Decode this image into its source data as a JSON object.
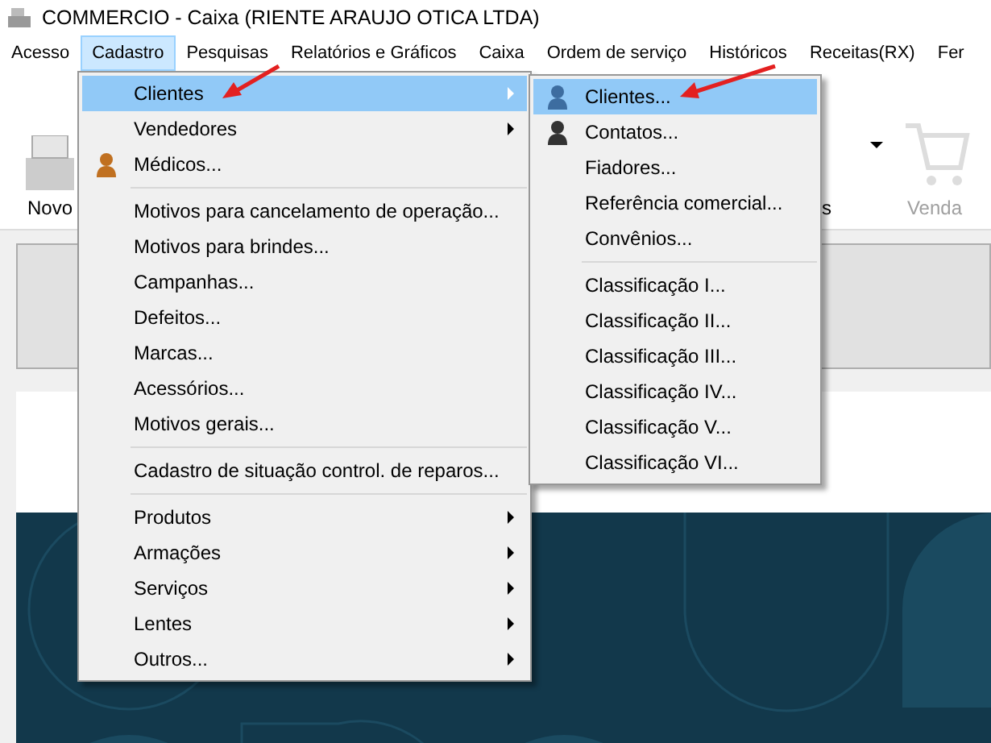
{
  "window": {
    "title": "COMMERCIO - Caixa (RIENTE ARAUJO OTICA LTDA)"
  },
  "menubar": [
    {
      "label": "Acesso",
      "selected": false
    },
    {
      "label": "Cadastro",
      "selected": true
    },
    {
      "label": "Pesquisas",
      "selected": false
    },
    {
      "label": "Relatórios e Gráficos",
      "selected": false
    },
    {
      "label": "Caixa",
      "selected": false
    },
    {
      "label": "Ordem de serviço",
      "selected": false
    },
    {
      "label": "Históricos",
      "selected": false
    },
    {
      "label": "Receitas(RX)",
      "selected": false
    },
    {
      "label": "Fer",
      "selected": false
    }
  ],
  "toolbar": [
    {
      "label": "Novo",
      "disabled": false
    },
    {
      "label": "s"
    },
    {
      "label": "Venda",
      "disabled": true
    }
  ],
  "menu": [
    {
      "kind": "item",
      "label": "Clientes",
      "selected": true,
      "submenu": true,
      "has_icon": false
    },
    {
      "kind": "item",
      "label": "Vendedores",
      "selected": false,
      "submenu": true,
      "has_icon": false
    },
    {
      "kind": "item",
      "label": "Médicos...",
      "selected": false,
      "submenu": false,
      "has_icon": true
    },
    {
      "kind": "separator"
    },
    {
      "kind": "item",
      "label": "Motivos para cancelamento de operação...",
      "selected": false,
      "submenu": false,
      "has_icon": false
    },
    {
      "kind": "item",
      "label": "Motivos para brindes...",
      "selected": false,
      "submenu": false,
      "has_icon": false
    },
    {
      "kind": "item",
      "label": "Campanhas...",
      "selected": false,
      "submenu": false,
      "has_icon": false
    },
    {
      "kind": "item",
      "label": "Defeitos...",
      "selected": false,
      "submenu": false,
      "has_icon": false
    },
    {
      "kind": "item",
      "label": "Marcas...",
      "selected": false,
      "submenu": false,
      "has_icon": false
    },
    {
      "kind": "item",
      "label": "Acessórios...",
      "selected": false,
      "submenu": false,
      "has_icon": false
    },
    {
      "kind": "item",
      "label": "Motivos gerais...",
      "selected": false,
      "submenu": false,
      "has_icon": false
    },
    {
      "kind": "separator"
    },
    {
      "kind": "item",
      "label": "Cadastro de situação control. de reparos...",
      "selected": false,
      "submenu": false,
      "has_icon": false
    },
    {
      "kind": "separator"
    },
    {
      "kind": "item",
      "label": "Produtos",
      "selected": false,
      "submenu": true,
      "has_icon": false
    },
    {
      "kind": "item",
      "label": "Armações",
      "selected": false,
      "submenu": true,
      "has_icon": false
    },
    {
      "kind": "item",
      "label": "Serviços",
      "selected": false,
      "submenu": true,
      "has_icon": false
    },
    {
      "kind": "item",
      "label": "Lentes",
      "selected": false,
      "submenu": true,
      "has_icon": false
    },
    {
      "kind": "item",
      "label": "Outros...",
      "selected": false,
      "submenu": true,
      "has_icon": false
    }
  ],
  "submenu": [
    {
      "kind": "item",
      "label": "Clientes...",
      "selected": true,
      "submenu": false,
      "has_icon": true
    },
    {
      "kind": "item",
      "label": "Contatos...",
      "selected": false,
      "submenu": false,
      "has_icon": true
    },
    {
      "kind": "item",
      "label": "Fiadores...",
      "selected": false,
      "submenu": false,
      "has_icon": false
    },
    {
      "kind": "item",
      "label": "Referência comercial...",
      "selected": false,
      "submenu": false,
      "has_icon": false
    },
    {
      "kind": "item",
      "label": "Convênios...",
      "selected": false,
      "submenu": false,
      "has_icon": false
    },
    {
      "kind": "separator"
    },
    {
      "kind": "item",
      "label": "Classificação I...",
      "selected": false,
      "submenu": false,
      "has_icon": false
    },
    {
      "kind": "item",
      "label": "Classificação II...",
      "selected": false,
      "submenu": false,
      "has_icon": false
    },
    {
      "kind": "item",
      "label": "Classificação III...",
      "selected": false,
      "submenu": false,
      "has_icon": false
    },
    {
      "kind": "item",
      "label": "Classificação IV...",
      "selected": false,
      "submenu": false,
      "has_icon": false
    },
    {
      "kind": "item",
      "label": "Classificação V...",
      "selected": false,
      "submenu": false,
      "has_icon": false
    },
    {
      "kind": "item",
      "label": "Classificação VI...",
      "selected": false,
      "submenu": false,
      "has_icon": false
    }
  ]
}
